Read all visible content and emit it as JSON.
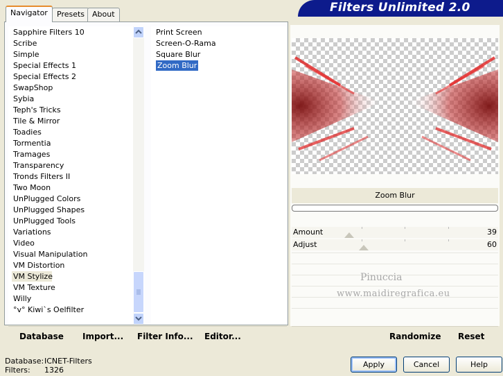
{
  "banner": {
    "title": "Filters Unlimited 2.0"
  },
  "tabs": [
    {
      "label": "Navigator",
      "active": true
    },
    {
      "label": "Presets",
      "active": false
    },
    {
      "label": "About",
      "active": false
    }
  ],
  "categories": [
    "Sapphire Filters 10",
    "Scribe",
    "Simple",
    "Special Effects 1",
    "Special Effects 2",
    "SwapShop",
    "Sybia",
    "Teph's Tricks",
    "Tile & Mirror",
    "Toadies",
    "Tormentia",
    "Tramages",
    "Transparency",
    "Tronds Filters II",
    "Two Moon",
    "UnPlugged Colors",
    "UnPlugged Shapes",
    "UnPlugged Tools",
    "Variations",
    "Video",
    "Visual Manipulation",
    "VM Distortion",
    "VM Stylize",
    "VM Texture",
    "Willy",
    "°v° Kiwi`s Oelfilter"
  ],
  "selected_category": "VM Stylize",
  "filters": [
    "Print Screen",
    "Screen-O-Rama",
    "Square Blur",
    "Zoom Blur"
  ],
  "selected_filter": "Zoom Blur",
  "preview": {
    "filter_name": "Zoom Blur",
    "progress": 0
  },
  "params": [
    {
      "label": "Amount",
      "value": "39",
      "fraction": 0.153
    },
    {
      "label": "Adjust",
      "value": "60",
      "fraction": 0.235
    }
  ],
  "watermark": {
    "line1": "Pinuccia",
    "line2": "www.maidiregrafica.eu"
  },
  "left_actions": {
    "database": "Database",
    "import": "Import...",
    "filter_info": "Filter Info...",
    "editor": "Editor..."
  },
  "right_actions": {
    "randomize": "Randomize",
    "reset": "Reset"
  },
  "status": {
    "database_label": "Database:",
    "database_value": "ICNET-Filters",
    "filters_label": "Filters:",
    "filters_value": "1326"
  },
  "buttons": {
    "apply": "Apply",
    "cancel": "Cancel",
    "help": "Help"
  },
  "colors": {
    "banner": "#0d1b8c",
    "selection": "#316ac5",
    "accent_red": "#e02020"
  }
}
